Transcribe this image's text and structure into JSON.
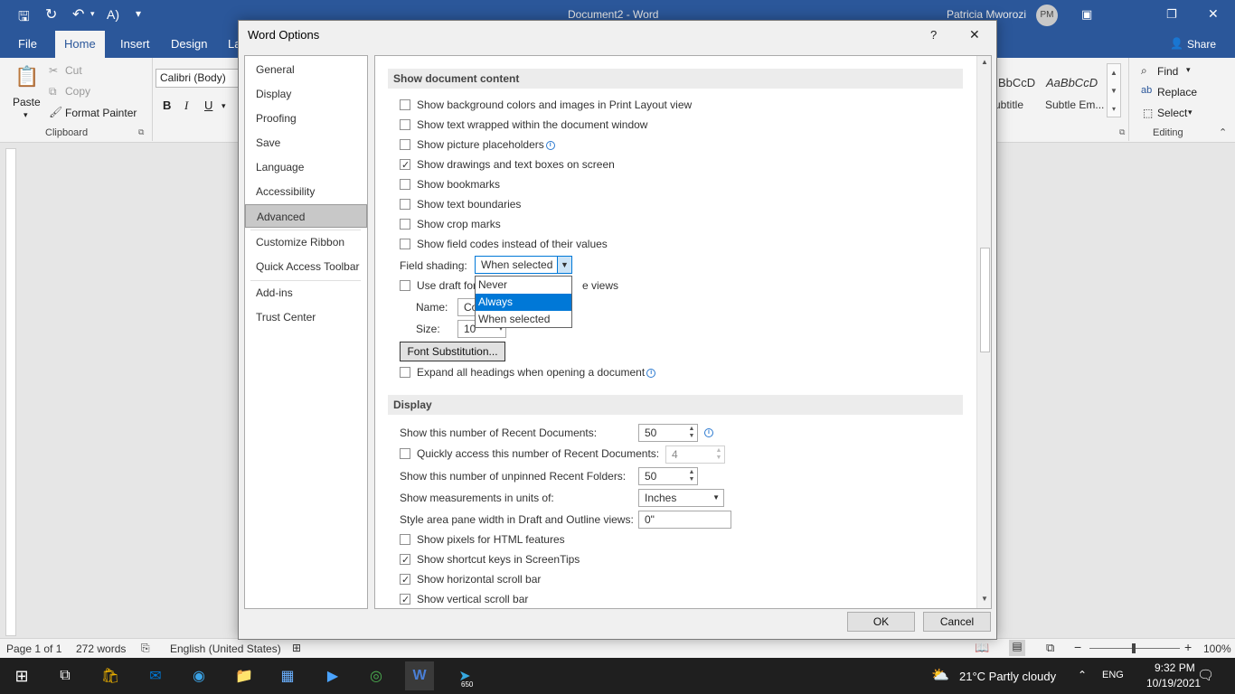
{
  "word": {
    "doc_title": "Document2  -  Word",
    "user_name": "Patricia Mworozi",
    "user_initials": "PM",
    "tabs": [
      "File",
      "Home",
      "Insert",
      "Design",
      "La"
    ],
    "share_label": "Share",
    "font_name": "Calibri (Body)",
    "clipboard": {
      "paste": "Paste",
      "cut": "Cut",
      "copy": "Copy",
      "format_painter": "Format Painter",
      "group": "Clipboard"
    },
    "styles": {
      "style1_preview": "BbCcD",
      "style1_name": "ubtitle",
      "style2_preview": "AaBbCcD",
      "style2_name": "Subtle Em..."
    },
    "editing": {
      "find": "Find",
      "replace": "Replace",
      "select": "Select",
      "group": "Editing"
    },
    "status": {
      "page": "Page 1 of 1",
      "words": "272 words",
      "language": "English (United States)",
      "zoom": "100%"
    }
  },
  "dialog": {
    "title": "Word Options",
    "nav": [
      "General",
      "Display",
      "Proofing",
      "Save",
      "Language",
      "Accessibility",
      "Advanced",
      "Customize Ribbon",
      "Quick Access Toolbar",
      "Add-ins",
      "Trust Center"
    ],
    "selected_nav": "Advanced",
    "show_content_header": "Show document content",
    "show_options": [
      {
        "label": "Show background colors and images in Print Layout view",
        "checked": false
      },
      {
        "label": "Show text wrapped within the document window",
        "checked": false
      },
      {
        "label": "Show picture placeholders",
        "checked": false
      },
      {
        "label": "Show drawings and text boxes on screen",
        "checked": true
      },
      {
        "label": "Show bookmarks",
        "checked": false
      },
      {
        "label": "Show text boundaries",
        "checked": false
      },
      {
        "label": "Show crop marks",
        "checked": false
      },
      {
        "label": "Show field codes instead of their values",
        "checked": false
      }
    ],
    "field_shading_label": "Field shading:",
    "field_shading_value": "When selected",
    "field_shading_options": [
      "Never",
      "Always",
      "When selected"
    ],
    "field_shading_highlighted": "Always",
    "draft_font_prefix": "Use draft for",
    "draft_font_suffix": "e views",
    "name_label": "Name:",
    "name_value": "Co",
    "size_label": "Size:",
    "size_value": "10",
    "font_substitution": "Font Substitution...",
    "expand_headings": "Expand all headings when opening a document",
    "display_header": "Display",
    "recent_docs_label": "Show this number of Recent Documents:",
    "recent_docs_value": "50",
    "quick_access_label": "Quickly access this number of Recent Documents:",
    "quick_access_value": "4",
    "recent_folders_label": "Show this number of unpinned Recent Folders:",
    "recent_folders_value": "50",
    "units_label": "Show measurements in units of:",
    "units_value": "Inches",
    "style_area_label": "Style area pane width in Draft and Outline views:",
    "style_area_value": "0\"",
    "display_options": [
      {
        "label": "Show pixels for HTML features",
        "checked": false
      },
      {
        "label": "Show shortcut keys in ScreenTips",
        "checked": true
      },
      {
        "label": "Show horizontal scroll bar",
        "checked": true
      },
      {
        "label": "Show vertical scroll bar",
        "checked": true
      }
    ],
    "ok": "OK",
    "cancel": "Cancel",
    "help": "?",
    "close": "✕"
  },
  "taskbar": {
    "weather": "21°C  Partly cloudy",
    "lang": "ENG",
    "time": "9:32 PM",
    "date": "10/19/2021",
    "badge": "650"
  }
}
